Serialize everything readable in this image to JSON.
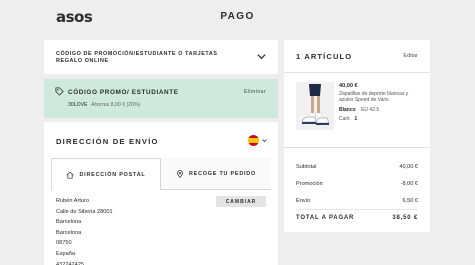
{
  "header": {
    "logo": "asos",
    "title": "PAGO"
  },
  "promo": {
    "section_label": "CÓDIGO DE PROMOCIÓN/ESTUDIANTE O TARJETAS REGALO ONLINE",
    "applied_title": "CÓDIGO PROMO/ ESTUDIANTE",
    "remove_label": "Eliminar",
    "code": "30LOVE",
    "saving": "Ahorras 8,00 € (20%)"
  },
  "address": {
    "title": "DIRECCIÓN DE ENVÍO",
    "tabs": [
      "DIRECCIÓN POSTAL",
      "RECOGE TU PEDIDO"
    ],
    "change_label": "CAMBIAR",
    "lines": [
      "Rubén Arturo",
      "Calle de Siberia 28001",
      "Barcelona",
      "Barcelona",
      "08750",
      "España",
      "432242425"
    ]
  },
  "summary": {
    "title": "1 ARTÍCULO",
    "edit_label": "Editar",
    "item": {
      "price": "40,00 €",
      "name": "Zapatillas de deporte blancas y azules Speed de Vans",
      "color": "Blanco",
      "size": "EU 42.5",
      "qty_label": "Cant.",
      "qty": "1"
    },
    "rows": [
      {
        "label": "Subtotal",
        "value": "40,00 €"
      },
      {
        "label": "Promoción",
        "value": "-8,00 €"
      },
      {
        "label": "Envío",
        "value": "6,50 €"
      }
    ],
    "total_label": "TOTAL A PAGAR",
    "total_value": "38,50 €"
  }
}
